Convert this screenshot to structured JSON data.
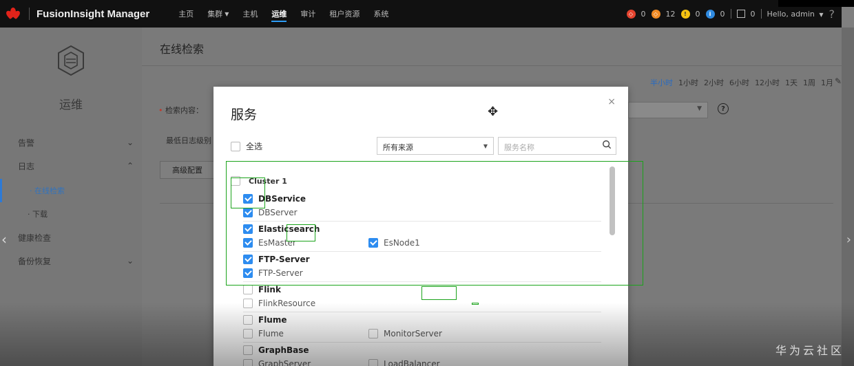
{
  "topbar": {
    "title": "FusionInsight Manager",
    "nav": [
      {
        "label": "主页",
        "active": false,
        "dropdown": false
      },
      {
        "label": "集群",
        "active": false,
        "dropdown": true
      },
      {
        "label": "主机",
        "active": false,
        "dropdown": false
      },
      {
        "label": "运维",
        "active": true,
        "dropdown": false
      },
      {
        "label": "审计",
        "active": false,
        "dropdown": false
      },
      {
        "label": "租户资源",
        "active": false,
        "dropdown": false
      },
      {
        "label": "系统",
        "active": false,
        "dropdown": false
      }
    ],
    "alarms": {
      "critical": "0",
      "major": "12",
      "minor": "0",
      "info": "0",
      "tasks": "0"
    },
    "user": "Hello, admin",
    "help": "?"
  },
  "sidebar": {
    "title": "运维",
    "items": [
      {
        "label": "告警",
        "chevron": "⌄",
        "sub": false
      },
      {
        "label": "日志",
        "chevron": "⌃",
        "sub": false
      },
      {
        "label": "· 在线检索",
        "chevron": "",
        "sub": true,
        "active": true
      },
      {
        "label": "· 下载",
        "chevron": "",
        "sub": true
      },
      {
        "label": "健康检查",
        "chevron": "",
        "sub": false
      },
      {
        "label": "备份恢复",
        "chevron": "⌄",
        "sub": false
      }
    ]
  },
  "main": {
    "page_title": "在线检索",
    "time_ranges": [
      "半小时",
      "1小时",
      "2小时",
      "6小时",
      "12小时",
      "1天",
      "1周",
      "1月"
    ],
    "time_active": "半小时",
    "search_content_label": "检索内容：",
    "required_mark": "•",
    "min_log_level_label": "最低日志级别",
    "advanced_button": "高级配置"
  },
  "modal": {
    "title": "服务",
    "close": "×",
    "select_all_label": "全选",
    "source_select_value": "所有来源",
    "search_placeholder": "服务名称",
    "cluster_label": "Cluster 1",
    "groups": [
      {
        "name": "DBService",
        "checked": true,
        "children": [
          {
            "name": "DBServer",
            "checked": true
          }
        ]
      },
      {
        "name": "Elasticsearch",
        "checked": true,
        "children": [
          {
            "name": "EsMaster",
            "checked": true
          },
          {
            "name": "EsNode1",
            "checked": true
          }
        ]
      },
      {
        "name": "FTP-Server",
        "checked": true,
        "children": [
          {
            "name": "FTP-Server",
            "checked": true
          }
        ]
      },
      {
        "name": "Flink",
        "checked": false,
        "children": [
          {
            "name": "FlinkResource",
            "checked": false
          }
        ]
      },
      {
        "name": "Flume",
        "checked": false,
        "children": [
          {
            "name": "Flume",
            "checked": false
          },
          {
            "name": "MonitorServer",
            "checked": false
          }
        ]
      },
      {
        "name": "GraphBase",
        "checked": false,
        "children": [
          {
            "name": "GraphServer",
            "checked": false
          },
          {
            "name": "LoadBalancer",
            "checked": false
          }
        ]
      }
    ]
  },
  "watermark": "华为云社区",
  "colors": {
    "accent": "#2d8cf0",
    "annotation": "#1aa31a",
    "brand": "#e2231a"
  }
}
